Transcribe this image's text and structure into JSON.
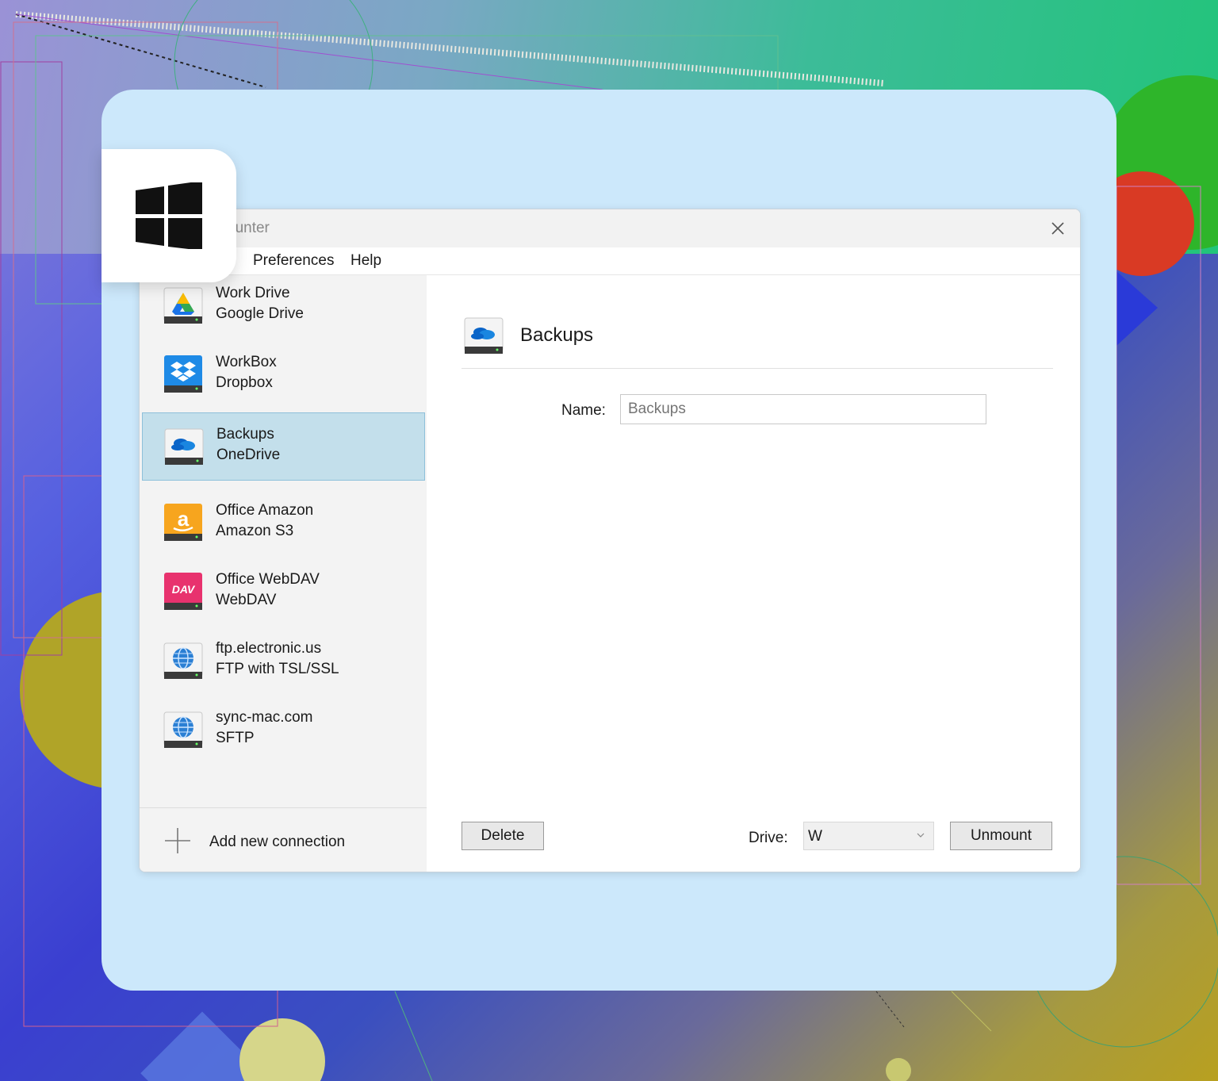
{
  "window": {
    "title_partial": "ounter",
    "close_icon": "close-icon"
  },
  "menu": {
    "items": [
      "Preferences",
      "Help"
    ]
  },
  "connections": [
    {
      "name": "Work Drive",
      "type": "Google Drive",
      "icon": "google-drive-icon",
      "selected": false
    },
    {
      "name": "WorkBox",
      "type": "Dropbox",
      "icon": "dropbox-icon",
      "selected": false
    },
    {
      "name": "Backups",
      "type": "OneDrive",
      "icon": "onedrive-icon",
      "selected": true
    },
    {
      "name": "Office Amazon",
      "type": "Amazon S3",
      "icon": "amazon-s3-icon",
      "selected": false
    },
    {
      "name": "Office WebDAV",
      "type": "WebDAV",
      "icon": "webdav-icon",
      "selected": false
    },
    {
      "name": "ftp.electronic.us",
      "type": "FTP with TSL/SSL",
      "icon": "ftp-icon",
      "selected": false
    },
    {
      "name": "sync-mac.com",
      "type": "SFTP",
      "icon": "sftp-icon",
      "selected": false
    }
  ],
  "add_connection": {
    "label": "Add new connection",
    "icon": "plus-icon"
  },
  "detail": {
    "title": "Backups",
    "name_label": "Name:",
    "name_placeholder": "Backups",
    "delete_label": "Delete",
    "drive_label": "Drive:",
    "drive_value": "W",
    "unmount_label": "Unmount"
  },
  "colors": {
    "card_bg": "#cce8fb",
    "selected_bg": "#c3dfeb",
    "sidebar_bg": "#f3f3f3"
  }
}
